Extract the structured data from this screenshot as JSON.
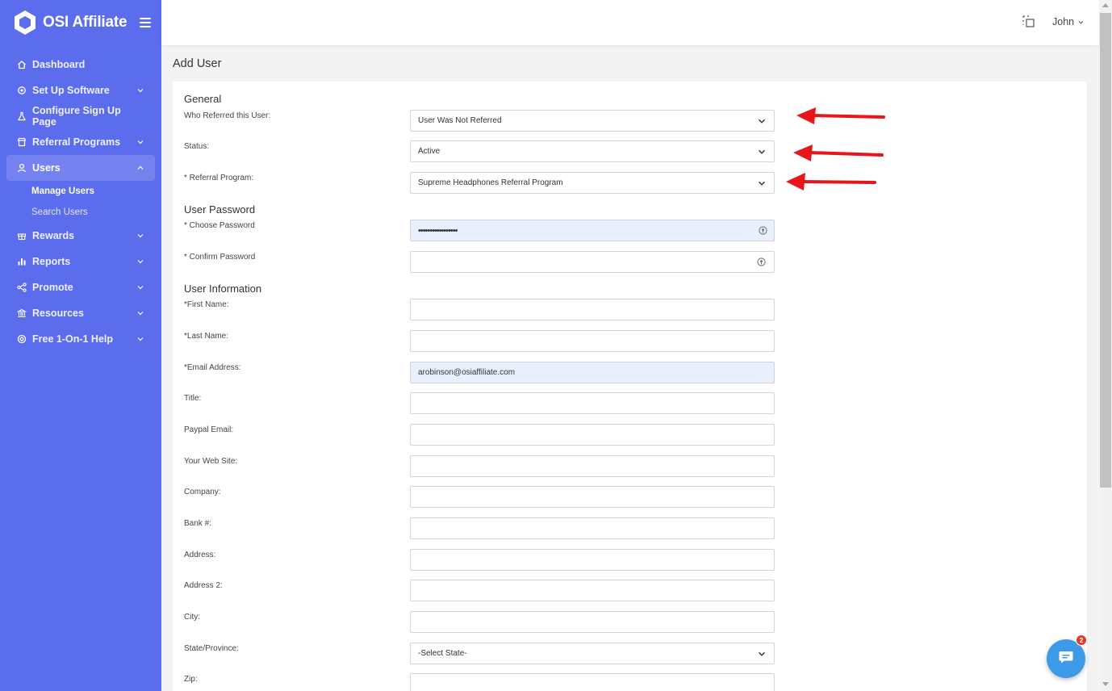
{
  "brand": {
    "name": "OSI Affiliate"
  },
  "colors": {
    "sidebar": "#5b6ded",
    "active_item": "#7483f0",
    "arrow": "#e8161a",
    "chat": "#3d9ae8",
    "badge": "#e03c2e"
  },
  "sidebar": {
    "items": [
      {
        "label": "Dashboard",
        "icon": "home-icon"
      },
      {
        "label": "Set Up Software",
        "icon": "gear-icon"
      },
      {
        "label": "Configure Sign Up Page",
        "icon": "flask-icon"
      },
      {
        "label": "Referral Programs",
        "icon": "store-icon"
      },
      {
        "label": "Users",
        "icon": "user-icon"
      },
      {
        "label": "Rewards",
        "icon": "gift-icon"
      },
      {
        "label": "Reports",
        "icon": "bar-chart-icon"
      },
      {
        "label": "Promote",
        "icon": "share-icon"
      },
      {
        "label": "Resources",
        "icon": "bank-icon"
      },
      {
        "label": "Free 1-On-1 Help",
        "icon": "lifebuoy-icon"
      }
    ],
    "users_sub": [
      "Manage Users",
      "Search Users"
    ]
  },
  "topbar": {
    "user": "John"
  },
  "page": {
    "title": "Add User"
  },
  "form": {
    "general_title": "General",
    "referred_label": "Who Referred this User:",
    "referred_value": "User Was Not Referred",
    "status_label": "Status:",
    "status_value": "Active",
    "program_label": "* Referral Program:",
    "program_value": "Supreme Headphones Referral Program",
    "password_title": "User Password",
    "choose_label": "* Choose Password",
    "choose_value": "•••••••••••••••••",
    "confirm_label": "* Confirm Password",
    "info_title": "User Information",
    "first_label": "*First Name:",
    "last_label": "*Last Name:",
    "email_label": "*Email Address:",
    "email_value": "arobinson@osiaffiliate.com",
    "title_label": "Title:",
    "paypal_label": "Paypal Email:",
    "website_label": "Your Web Site:",
    "company_label": "Company:",
    "bank_label": "Bank #:",
    "address_label": "Address:",
    "address2_label": "Address 2:",
    "city_label": "City:",
    "state_label": "State/Province:",
    "state_value": "-Select State-",
    "zip_label": "Zip:"
  },
  "chat": {
    "badge": "2"
  }
}
